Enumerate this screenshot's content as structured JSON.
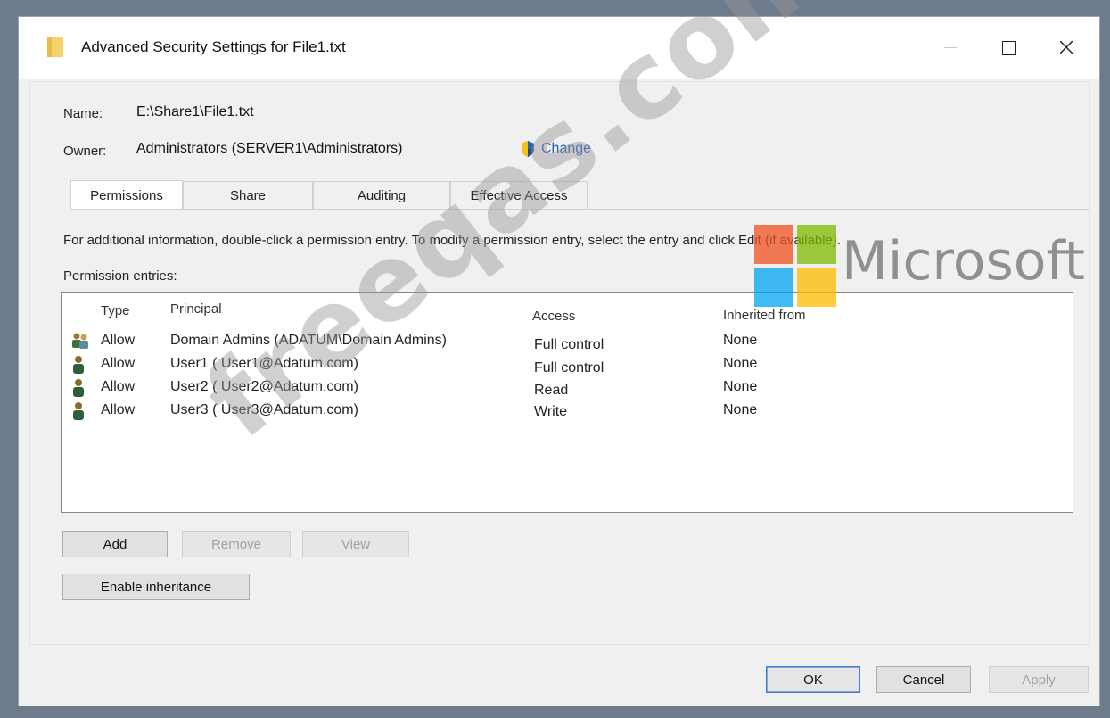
{
  "window": {
    "title": "Advanced Security Settings for File1.txt"
  },
  "details": {
    "name_label": "Name:",
    "name_value": "E:\\Share1\\File1.txt",
    "owner_label": "Owner:",
    "owner_value": "Administrators (SERVER1\\Administrators)",
    "change_label": "Change"
  },
  "tabs": [
    {
      "label": "Permissions"
    },
    {
      "label": "Share"
    },
    {
      "label": "Auditing"
    },
    {
      "label": "Effective Access"
    }
  ],
  "info_text": "For additional information, double-click a permission entry. To modify a permission entry, select the entry and click Edit (if available).",
  "entries_label": "Permission entries:",
  "table": {
    "headers": {
      "type": "Type",
      "principal": "Principal",
      "access": "Access",
      "inherited": "Inherited from"
    },
    "rows": [
      {
        "icon": "group-icon",
        "type": "Allow",
        "principal": "Domain Admins (ADATUM\\Domain Admins)",
        "access": "Full control",
        "inherited": "None"
      },
      {
        "icon": "user-icon",
        "type": "Allow",
        "principal": "User1 ( User1@Adatum.com)",
        "access": "Full control",
        "inherited": "None"
      },
      {
        "icon": "user-icon",
        "type": "Allow",
        "principal": "User2 ( User2@Adatum.com)",
        "access": "Read",
        "inherited": "None"
      },
      {
        "icon": "user-icon",
        "type": "Allow",
        "principal": "User3 ( User3@Adatum.com)",
        "access": "Write",
        "inherited": "None"
      }
    ]
  },
  "buttons": {
    "add": "Add",
    "remove": "Remove",
    "view": "View",
    "enable_inheritance": "Enable inheritance",
    "ok": "OK",
    "cancel": "Cancel",
    "apply": "Apply"
  },
  "overlays": {
    "watermark": "freeqas.com",
    "brand": "Microsoft"
  },
  "colors": {
    "link": "#1f5fbf",
    "ms_red": "#f25022",
    "ms_green": "#7fba00",
    "ms_blue": "#00a4ef",
    "ms_yellow": "#ffb900"
  }
}
